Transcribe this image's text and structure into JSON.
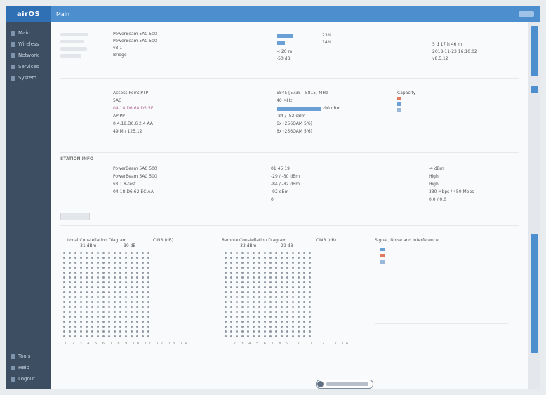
{
  "app": {
    "brand": "airOS",
    "page_title": "Main"
  },
  "sidebar": {
    "items": [
      "Main",
      "Wireless",
      "Network",
      "Services",
      "System"
    ],
    "bottom": [
      "Tools",
      "Help",
      "Logout"
    ]
  },
  "device": {
    "row1": [
      "PowerBeam 5AC 500",
      "PowerBeam 5AC 500",
      "v8.1",
      "Bridge"
    ],
    "row1_mid": [
      "23%",
      "14%",
      "< 20 m",
      "-50 dBi"
    ],
    "row1_right": [
      "5 d 17 h 46 m",
      "2018-11-23 16:10:02",
      "v8.5.12"
    ],
    "row2": [
      "Access Point PTP",
      "5AC",
      "04:18:D6:68:D5:5E",
      "APIPP",
      "0.4.18.D6.6 2.4 AA",
      "49 M / 125.12"
    ],
    "row2_mid": [
      "5845 [5735 - 5815] MHz",
      "40 MHz",
      "-90 dBm",
      "-84 / -82 dBm",
      "6x (256QAM 5/6)",
      "6x (256QAM 5/6)"
    ],
    "capacity_label": "Capacity",
    "station_label": "STATION INFO",
    "row3": [
      "PowerBeam 5AC 500",
      "PowerBeam 5AC 500",
      "v8.1.8-test",
      "04:18:D6:62:EC:AA"
    ],
    "row3_mid": [
      "01:45:19",
      "-29 / -30 dBm",
      "-84 / -82 dBm",
      "-92 dBm",
      "0"
    ],
    "row3_right": [
      "-4 dBm",
      "High",
      "High",
      "330 Mbps / 450 Mbps",
      "0.0 / 0.0"
    ]
  },
  "diagrams": {
    "local": {
      "title": "Local Constellation Diagram",
      "cinr": "CINR (dB)",
      "s1": "-31 dBm",
      "s2": "30 dB"
    },
    "remote": {
      "title": "Remote Constellation Diagram",
      "cinr": "CINR (dB)",
      "s1": "-33 dBm",
      "s2": "29 dB"
    },
    "signal": {
      "title": "Signal, Noise and Interference"
    },
    "axis": "1 2 3 4 5 6 7 8 9 10 11 12 13 14"
  },
  "colors": {
    "accent": "#4d8fce",
    "sidebar": "#3d4e63",
    "bar": "#6aa0d6"
  }
}
